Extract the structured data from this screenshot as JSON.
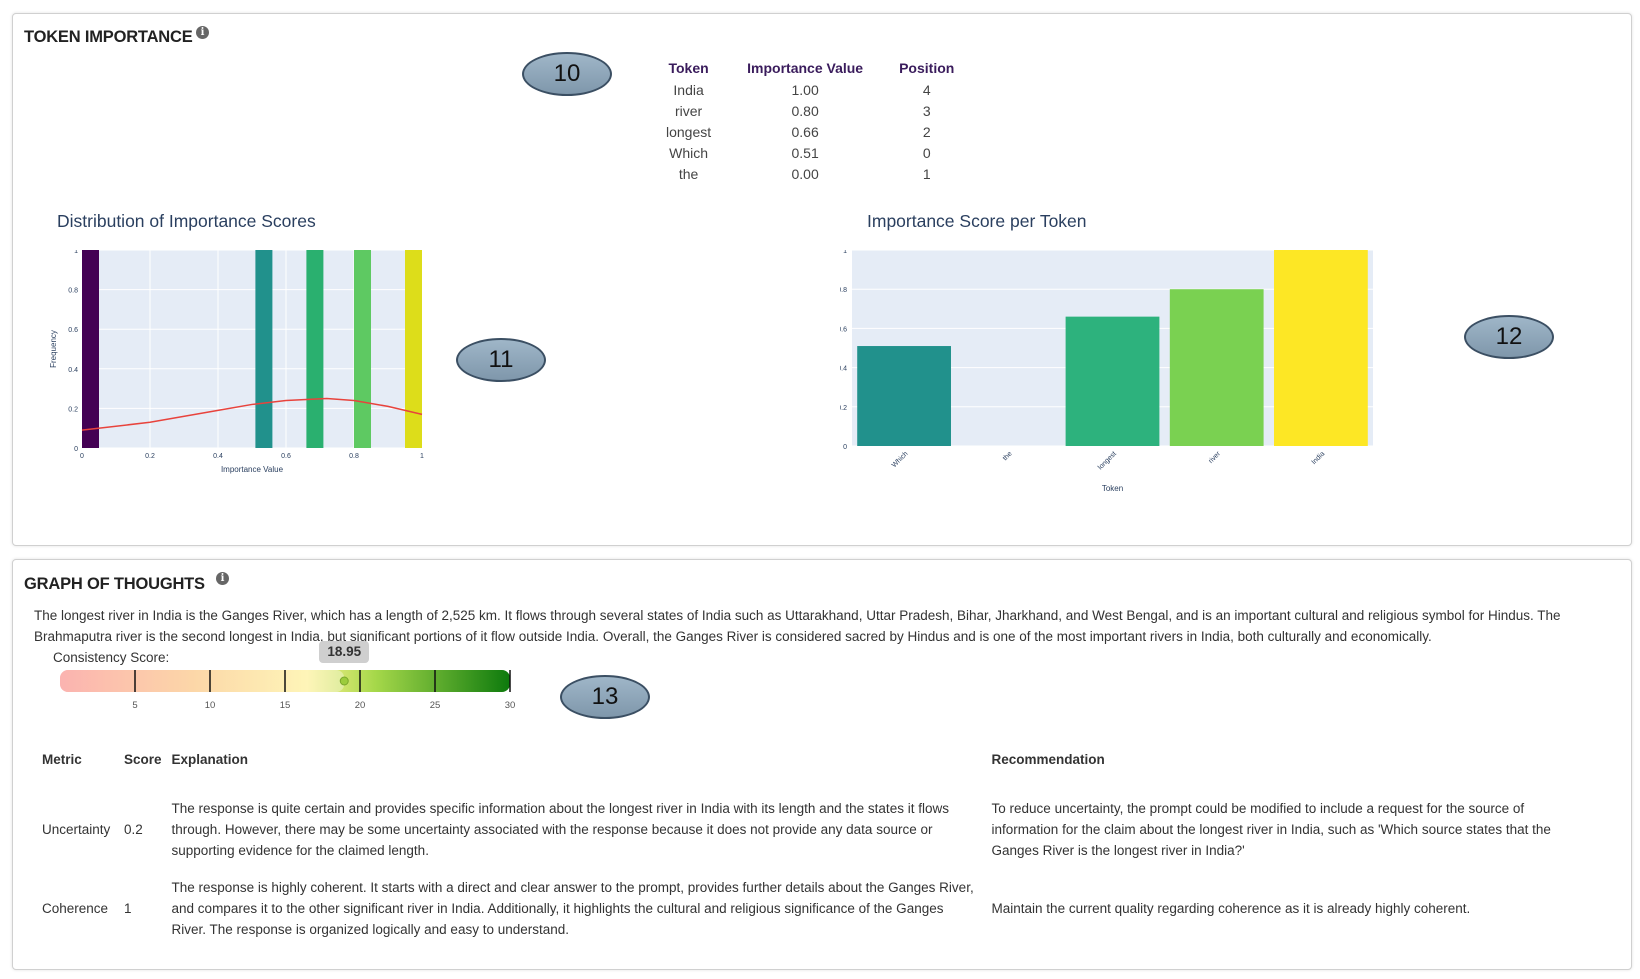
{
  "token_importance": {
    "title": "TOKEN IMPORTANCE",
    "info": "i",
    "table": {
      "headers": [
        "Token",
        "Importance Value",
        "Position"
      ],
      "rows": [
        [
          "India",
          "1.00",
          "4"
        ],
        [
          "river",
          "0.80",
          "3"
        ],
        [
          "longest",
          "0.66",
          "2"
        ],
        [
          "Which",
          "0.51",
          "0"
        ],
        [
          "the",
          "0.00",
          "1"
        ]
      ]
    }
  },
  "callouts": [
    "10",
    "11",
    "12",
    "13"
  ],
  "chart_data": [
    {
      "type": "bar",
      "title": "Distribution of Importance Scores",
      "xlabel": "Importance Value",
      "ylabel": "Frequency",
      "xlim": [
        0,
        1
      ],
      "ylim": [
        0,
        1
      ],
      "xticks": [
        "0",
        "0.2",
        "0.4",
        "0.6",
        "0.8",
        "1"
      ],
      "yticks": [
        "0",
        "0.2",
        "0.4",
        "0.6",
        "0.8",
        "1"
      ],
      "bars": [
        {
          "x": 0.0,
          "value": 1,
          "color": "#440154"
        },
        {
          "x": 0.51,
          "value": 1,
          "color": "#21918c"
        },
        {
          "x": 0.66,
          "value": 1,
          "color": "#2ab06f"
        },
        {
          "x": 0.8,
          "value": 1,
          "color": "#5ec962"
        },
        {
          "x": 1.0,
          "value": 1,
          "color": "#dddd1a"
        }
      ],
      "kde": {
        "x": [
          0,
          0.2,
          0.4,
          0.5,
          0.6,
          0.72,
          0.8,
          0.9,
          1.0
        ],
        "y": [
          0.09,
          0.13,
          0.19,
          0.22,
          0.24,
          0.25,
          0.24,
          0.21,
          0.17
        ],
        "color": "#e8433c"
      },
      "grid": true
    },
    {
      "type": "bar",
      "title": "Importance Score per Token",
      "xlabel": "Token",
      "ylabel": "Importance Value",
      "ylim": [
        0,
        1
      ],
      "yticks": [
        "0",
        "0.2",
        "0.4",
        "0.6",
        "0.8",
        "1"
      ],
      "categories": [
        "Which",
        "the",
        "longest",
        "river",
        "India"
      ],
      "values": [
        0.51,
        0.0,
        0.66,
        0.8,
        1.0
      ],
      "colors": [
        "#21918c",
        "#3b528b",
        "#2db27d",
        "#7ad151",
        "#fde725"
      ],
      "grid": true
    }
  ],
  "graph_of_thoughts": {
    "title": "GRAPH OF THOUGHTS",
    "info": "i",
    "paragraph": "The longest river in India is the Ganges River, which has a length of 2,525 km. It flows through several states of India such as Uttarakhand, Uttar Pradesh, Bihar, Jharkhand, and West Bengal, and is an important cultural and religious symbol for Hindus. The Brahmaputra river is the second longest in India, but significant portions of it flow outside India. Overall, the Ganges River is considered sacred by Hindus and is one of the most important rivers in India, both culturally and economically.",
    "consistency_label": "Consistency Score:",
    "consistency_value": 18.95,
    "consistency_display": "18.95",
    "slider_min": 0,
    "slider_max": 30,
    "slider_ticks": [
      "5",
      "10",
      "15",
      "20",
      "25",
      "30"
    ],
    "metrics_headers": [
      "Metric",
      "Score",
      "Explanation",
      "Recommendation"
    ],
    "metrics": [
      {
        "metric": "Uncertainty",
        "score": "0.2",
        "explanation": "The response is quite certain and provides specific information about the longest river in India with its length and the states it flows through. However, there may be some uncertainty associated with the response because it does not provide any data source or supporting evidence for the claimed length.",
        "recommendation": "To reduce uncertainty, the prompt could be modified to include a request for the source of information for the claim about the longest river in India, such as 'Which source states that the Ganges River is the longest river in India?'"
      },
      {
        "metric": "Coherence",
        "score": "1",
        "explanation": "The response is highly coherent. It starts with a direct and clear answer to the prompt, provides further details about the Ganges River, and compares it to the other significant river in India. Additionally, it highlights the cultural and religious significance of the Ganges River. The response is organized logically and easy to understand.",
        "recommendation": "Maintain the current quality regarding coherence as it is already highly coherent."
      }
    ]
  }
}
